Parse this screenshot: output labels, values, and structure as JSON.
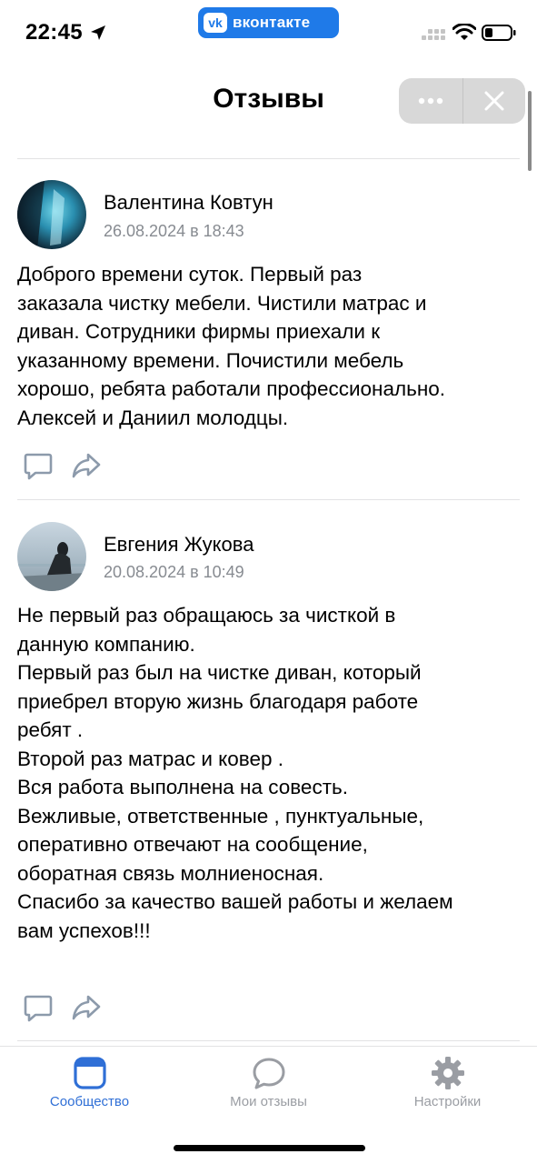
{
  "status_bar": {
    "time": "22:45",
    "app_badge": "вконтакте",
    "vk_logo_text": "vk",
    "icons": [
      "location-arrow-icon",
      "signal-icon",
      "wifi-icon",
      "battery-icon"
    ]
  },
  "header": {
    "title": "Отзывы",
    "icons": [
      "more-icon",
      "close-icon"
    ]
  },
  "reviews": [
    {
      "author": "Валентина Ковтун",
      "date": "26.08.2024 в 18:43",
      "text": "Доброго времени суток. Первый раз\nзаказала чистку мебели. Чистили матрас и\nдиван. Сотрудники фирмы приехали к\nуказанному времени. Почистили мебель\nхорошо, ребята работали профессионально.\nАлексей и Даниил молодцы."
    },
    {
      "author": "Евгения Жукова",
      "date": "20.08.2024 в 10:49",
      "text": "Не первый раз обращаюсь за чисткой в\nданную компанию.\nПервый раз был на чистке диван, который\nприебрел вторую жизнь благодаря работе\nребят .\nВторой раз матрас и ковер .\nВся работа выполнена на совесть.\nВежливые, ответственные , пунктуальные,\nоперативно отвечают на сообщение,\nоборатная связь молниеносная.\nСпасибо за качество вашей работы и желаем\nвам успехов!!!"
    }
  ],
  "review_action_icons": [
    "comment-icon",
    "share-icon"
  ],
  "bottom_nav": [
    {
      "label": "Сообщество",
      "icon": "community-icon",
      "active": true
    },
    {
      "label": "Мои отзывы",
      "icon": "chat-bubble-icon",
      "active": false
    },
    {
      "label": "Настройки",
      "icon": "gear-icon",
      "active": false
    }
  ],
  "colors": {
    "accent": "#2f6fd6",
    "vk_blue": "#1f7ae8",
    "secondary_text": "#878b91",
    "inactive": "#9a9da3"
  }
}
